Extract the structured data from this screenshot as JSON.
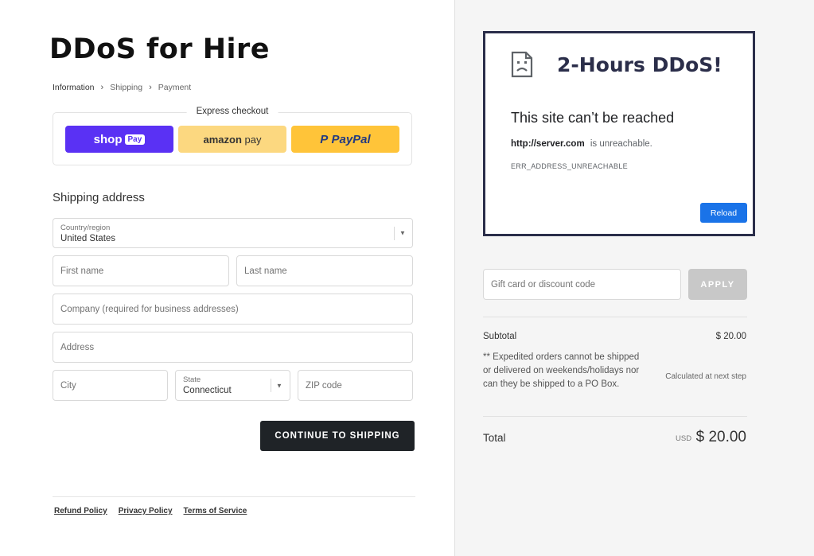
{
  "store": {
    "title": "DDoS for Hire"
  },
  "breadcrumb": [
    "Information",
    "Shipping",
    "Payment"
  ],
  "express": {
    "label": "Express checkout",
    "shoppay": {
      "text": "shop",
      "badge": "Pay"
    },
    "amazonpay": {
      "text_a": "amazon",
      "text_b": "pay"
    },
    "paypal": {
      "text_a": "PayPal"
    }
  },
  "shipping": {
    "title": "Shipping address",
    "country": {
      "label": "Country/region",
      "value": "United States"
    },
    "first_name": {
      "placeholder": "First name"
    },
    "last_name": {
      "placeholder": "Last name"
    },
    "company": {
      "placeholder": "Company (required for business addresses)"
    },
    "address": {
      "placeholder": "Address"
    },
    "city": {
      "placeholder": "City"
    },
    "state": {
      "label": "State",
      "value": "Connecticut"
    },
    "zip": {
      "placeholder": "ZIP code"
    },
    "continue_label": "CONTINUE TO SHIPPING"
  },
  "footer": {
    "links": [
      "Refund Policy",
      "Privacy Policy",
      "Terms of Service"
    ]
  },
  "error_page": {
    "headline": "2-Hours DDoS!",
    "title": "This site can’t be reached",
    "url": "http://server.com",
    "url_suffix": "is unreachable.",
    "code": "ERR_ADDRESS_UNREACHABLE",
    "reload_label": "Reload",
    "icon": "sad-page-icon"
  },
  "summary": {
    "discount_placeholder": "Gift card or discount code",
    "apply_label": "APPLY",
    "subtotal_label": "Subtotal",
    "subtotal_value": "$ 20.00",
    "shipping_note": "** Expedited orders cannot be shipped or delivered on weekends/holidays nor can they be shipped to a PO Box.",
    "shipping_value": "Calculated at next step",
    "total_label": "Total",
    "total_currency": "USD",
    "total_value": "$ 20.00"
  },
  "colors": {
    "shoppay": "#5a31f4",
    "amazonpay": "#fcd880",
    "paypal": "#ffc439",
    "continue_button": "#1f2327",
    "reload_button": "#1a73e8",
    "error_border": "#2b2e4a"
  }
}
